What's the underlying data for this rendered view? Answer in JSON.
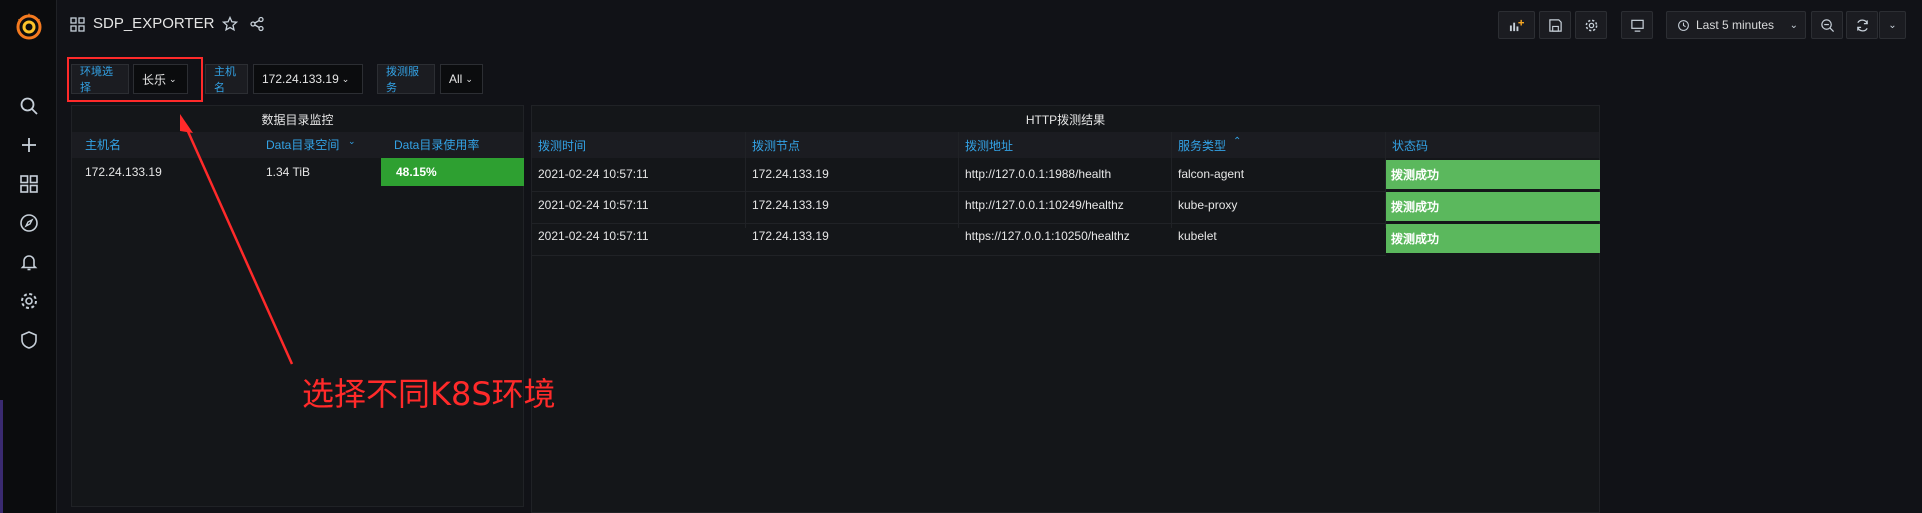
{
  "dashboard": {
    "title": "SDP_EXPORTER"
  },
  "toolbar": {
    "time_range": "Last 5 minutes"
  },
  "variables": [
    {
      "label": "环境选择",
      "value": "长乐"
    },
    {
      "label": "主机名",
      "value": "172.24.133.19"
    },
    {
      "label": "拨测服务",
      "value": "All"
    }
  ],
  "disk_panel": {
    "title": "数据目录监控",
    "columns": [
      "主机名",
      "Data目录空间",
      "Data目录使用率"
    ],
    "rows": [
      {
        "host": "172.24.133.19",
        "space": "1.34 TiB",
        "usage": "48.15%"
      }
    ]
  },
  "http_panel": {
    "title": "HTTP拨测结果",
    "columns": [
      "拨测时间",
      "拨测节点",
      "拨测地址",
      "服务类型",
      "状态码"
    ],
    "rows": [
      {
        "time": "2021-02-24 10:57:11",
        "node": "172.24.133.19",
        "url": "http://127.0.0.1:1988/health",
        "type": "falcon-agent",
        "status": "拨测成功"
      },
      {
        "time": "2021-02-24 10:57:11",
        "node": "172.24.133.19",
        "url": "http://127.0.0.1:10249/healthz",
        "type": "kube-proxy",
        "status": "拨测成功"
      },
      {
        "time": "2021-02-24 10:57:11",
        "node": "172.24.133.19",
        "url": "https://127.0.0.1:10250/healthz",
        "type": "kubelet",
        "status": "拨测成功"
      }
    ]
  },
  "annotation": {
    "text": "选择不同K8S环境"
  },
  "colors": {
    "accent": "#33a2e5",
    "usage_green": "#2ea031",
    "status_green": "#5bb85d",
    "annotation_red": "#ff2a2a"
  }
}
